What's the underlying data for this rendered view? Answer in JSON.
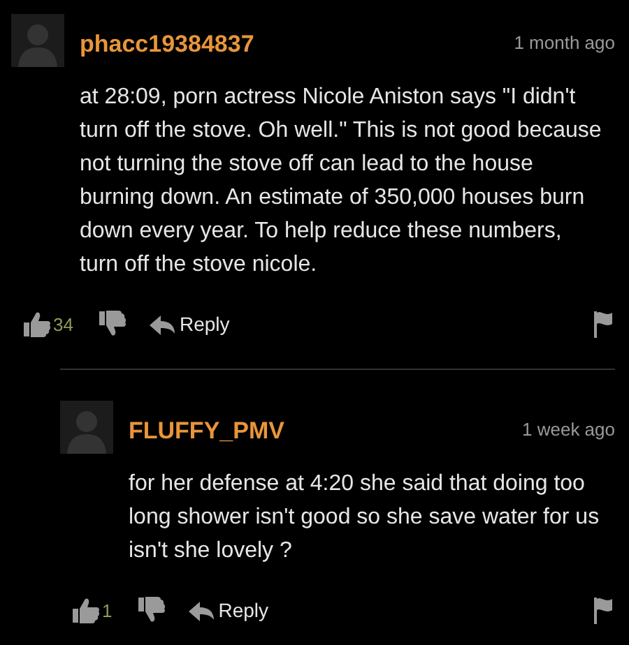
{
  "comments": [
    {
      "username": "phacc19384837",
      "time": "1 month ago",
      "text": "at 28:09, porn actress Nicole Aniston says \"I didn't turn off the stove. Oh well.\" This is not good because not turning the stove off can lead to the house burning down. An estimate of 350,000 houses burn down every year. To help reduce these numbers, turn off the stove nicole.",
      "likes": "34",
      "reply_label": "Reply",
      "children": [
        {
          "username": "FLUFFY_PMV",
          "time": "1 week ago",
          "text": "for her defense at 4:20 she said that doing too long shower isn't good so she save water for us isn't she lovely ?",
          "likes": "1",
          "reply_label": "Reply"
        }
      ]
    }
  ]
}
